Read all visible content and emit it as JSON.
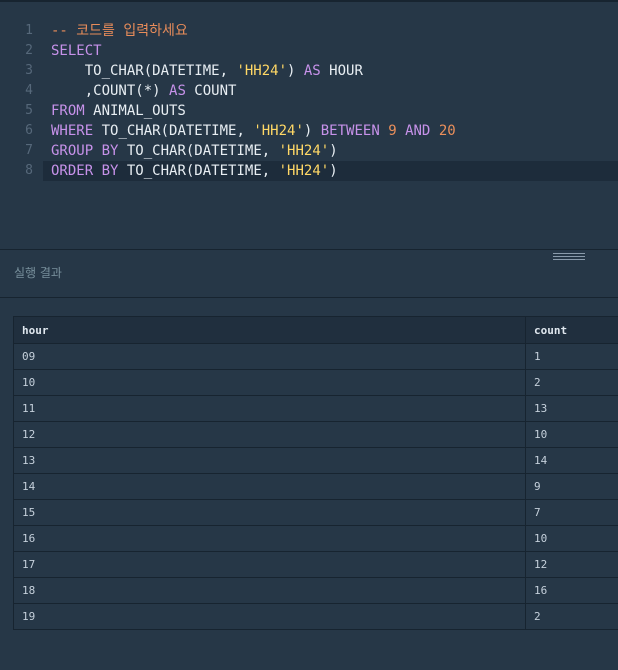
{
  "editor": {
    "lines": [
      {
        "no": "1",
        "tokens": [
          {
            "t": "-- 코드를 입력하세요",
            "c": "cm"
          }
        ]
      },
      {
        "no": "2",
        "tokens": [
          {
            "t": "SELECT",
            "c": "kw"
          }
        ]
      },
      {
        "no": "3",
        "tokens": [
          {
            "t": "    TO_CHAR(DATETIME, ",
            "c": "pl"
          },
          {
            "t": "'HH24'",
            "c": "str"
          },
          {
            "t": ") ",
            "c": "pl"
          },
          {
            "t": "AS",
            "c": "kw"
          },
          {
            "t": " HOUR",
            "c": "pl"
          }
        ]
      },
      {
        "no": "4",
        "tokens": [
          {
            "t": "    ,COUNT(*) ",
            "c": "pl"
          },
          {
            "t": "AS",
            "c": "kw"
          },
          {
            "t": " COUNT",
            "c": "pl"
          }
        ]
      },
      {
        "no": "5",
        "tokens": [
          {
            "t": "FROM",
            "c": "kw"
          },
          {
            "t": " ANIMAL_OUTS",
            "c": "pl"
          }
        ]
      },
      {
        "no": "6",
        "tokens": [
          {
            "t": "WHERE",
            "c": "kw"
          },
          {
            "t": " TO_CHAR(DATETIME, ",
            "c": "pl"
          },
          {
            "t": "'HH24'",
            "c": "str"
          },
          {
            "t": ") ",
            "c": "pl"
          },
          {
            "t": "BETWEEN",
            "c": "kw"
          },
          {
            "t": " ",
            "c": "pl"
          },
          {
            "t": "9",
            "c": "num"
          },
          {
            "t": " ",
            "c": "pl"
          },
          {
            "t": "AND",
            "c": "kw"
          },
          {
            "t": " ",
            "c": "pl"
          },
          {
            "t": "20",
            "c": "num"
          }
        ]
      },
      {
        "no": "7",
        "tokens": [
          {
            "t": "GROUP",
            "c": "kw"
          },
          {
            "t": " ",
            "c": "pl"
          },
          {
            "t": "BY",
            "c": "kw"
          },
          {
            "t": " TO_CHAR(DATETIME, ",
            "c": "pl"
          },
          {
            "t": "'HH24'",
            "c": "str"
          },
          {
            "t": ")",
            "c": "pl"
          }
        ]
      },
      {
        "no": "8",
        "tokens": [
          {
            "t": "ORDER",
            "c": "kw"
          },
          {
            "t": " ",
            "c": "pl"
          },
          {
            "t": "BY",
            "c": "kw"
          },
          {
            "t": " TO_CHAR(DATETIME, ",
            "c": "pl"
          },
          {
            "t": "'HH24'",
            "c": "str"
          },
          {
            "t": ")",
            "c": "pl"
          }
        ]
      }
    ]
  },
  "results": {
    "title": "실행 결과",
    "columns": [
      "hour",
      "count"
    ],
    "rows": [
      [
        "09",
        "1"
      ],
      [
        "10",
        "2"
      ],
      [
        "11",
        "13"
      ],
      [
        "12",
        "10"
      ],
      [
        "13",
        "14"
      ],
      [
        "14",
        "9"
      ],
      [
        "15",
        "7"
      ],
      [
        "16",
        "10"
      ],
      [
        "17",
        "12"
      ],
      [
        "18",
        "16"
      ],
      [
        "19",
        "2"
      ]
    ]
  },
  "colors": {
    "background": "#263747",
    "keyword": "#c792ea",
    "string": "#ffd866",
    "number": "#ea8f5b",
    "comment": "#e88c5a"
  }
}
